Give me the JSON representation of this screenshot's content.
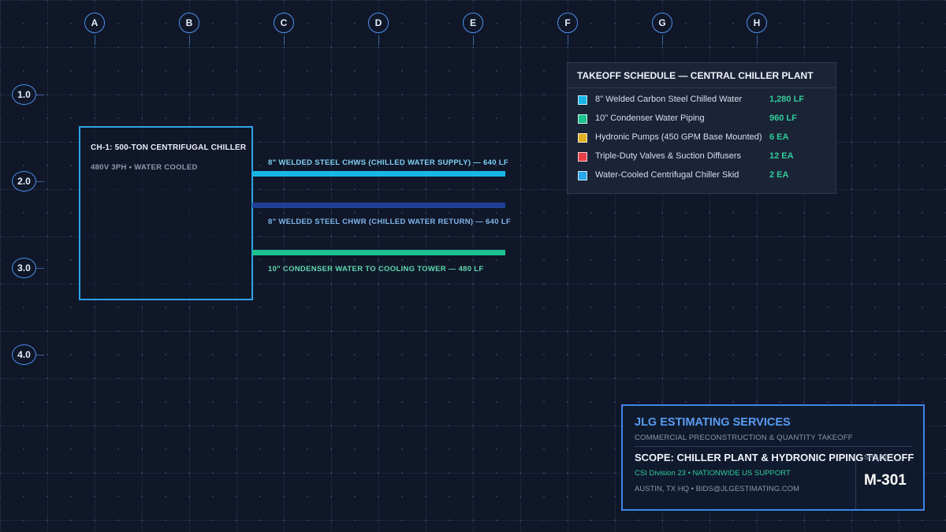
{
  "grid": {
    "columns": [
      "A",
      "B",
      "C",
      "D",
      "E",
      "F",
      "G",
      "H"
    ],
    "rows": [
      "1.0",
      "2.0",
      "3.0",
      "4.0"
    ]
  },
  "chiller": {
    "name": "CH-1: 500-TON CENTRIFUGAL CHILLER",
    "spec": "480V 3PH • WATER COOLED",
    "border_color": "#2ea3e6"
  },
  "pipes": [
    {
      "label": "8\" WELDED STEEL CHWS (CHILLED WATER SUPPLY) — 640 LF",
      "color": "#19b6e6",
      "label_color": "#7fd0f2"
    },
    {
      "label": "8\" WELDED STEEL CHWR (CHILLED WATER RETURN) — 640 LF",
      "color": "#1f3f95",
      "label_color": "#7fb6ea"
    },
    {
      "label": "10\" CONDENSER WATER TO COOLING TOWER — 480 LF",
      "color": "#1cc28f",
      "label_color": "#5fd8b0"
    }
  ],
  "schedule": {
    "title": "TAKEOFF SCHEDULE — CENTRAL CHILLER PLANT",
    "items": [
      {
        "description": "8\" Welded Carbon Steel Chilled Water",
        "quantity": "1,280 LF",
        "color": "#19b6e6"
      },
      {
        "description": "10\" Condenser Water Piping",
        "quantity": "960 LF",
        "color": "#1cc28f"
      },
      {
        "description": "Hydronic Pumps (450 GPM Base Mounted)",
        "quantity": "6 EA",
        "color": "#e0b021"
      },
      {
        "description": "Triple-Duty Valves & Suction Diffusers",
        "quantity": "12 EA",
        "color": "#e8404a"
      },
      {
        "description": "Water-Cooled Centrifugal Chiller Skid",
        "quantity": "2 EA",
        "color": "#2aa7e8"
      }
    ]
  },
  "titleblock": {
    "company": "JLG ESTIMATING SERVICES",
    "tagline": "COMMERCIAL PRECONSTRUCTION & QUANTITY TAKEOFF",
    "scope": "SCOPE: CHILLER PLANT & HYDRONIC PIPING TAKEOFF",
    "division": "CSI Division 23 • NATIONWIDE US SUPPORT",
    "location": "AUSTIN, TX HQ • BIDS@JLGESTIMATING.COM",
    "sheet_label": "SHEET",
    "sheet_number": "M-301"
  }
}
